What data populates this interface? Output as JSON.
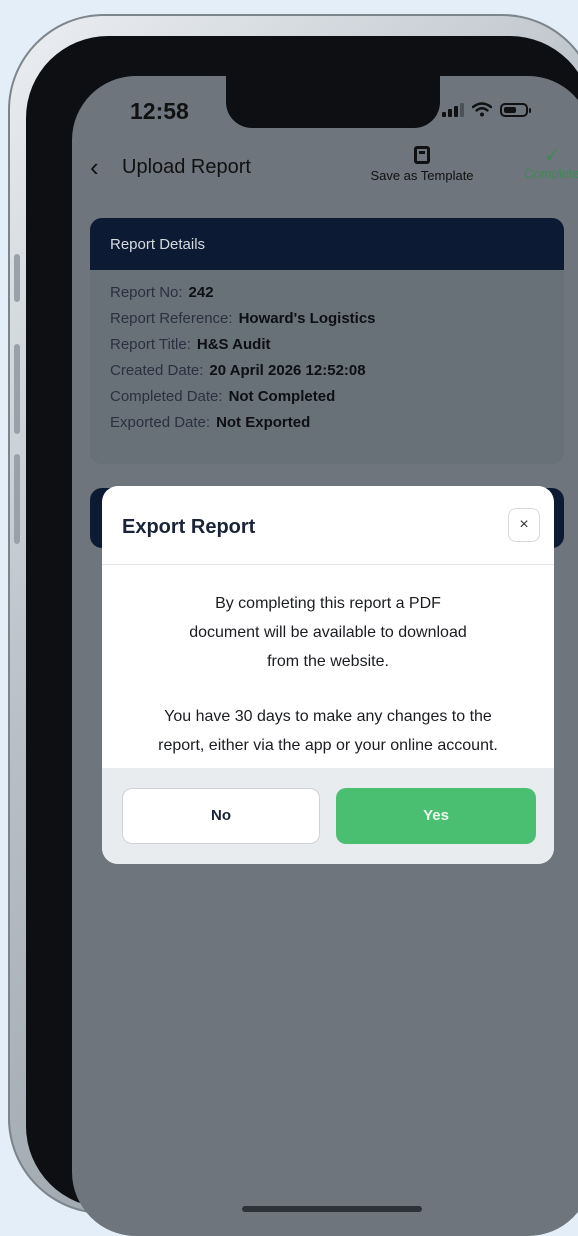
{
  "status": {
    "time": "12:58"
  },
  "header": {
    "title": "Upload Report",
    "save_template": "Save as Template",
    "complete": "Complete"
  },
  "card": {
    "title": "Report Details",
    "rows": [
      {
        "label": "Report No:",
        "value": "242"
      },
      {
        "label": "Report Reference:",
        "value": "Howard's Logistics"
      },
      {
        "label": "Report Title:",
        "value": "H&S Audit"
      },
      {
        "label": "Created Date:",
        "value": "20 April 2026 12:52:08"
      },
      {
        "label": "Completed Date:",
        "value": "Not Completed"
      },
      {
        "label": "Exported Date:",
        "value": "Not Exported"
      }
    ]
  },
  "modal": {
    "title": "Export Report",
    "close": "×",
    "line1": "By completing this report a PDF",
    "line2": "document will be available to download",
    "line3": "from the website.",
    "line4": "You have 30 days to make any changes to the",
    "line5": "report, either via the app or your online account.",
    "no_label": "No",
    "yes_label": "Yes"
  },
  "colors": {
    "accent_green": "#4bbf71",
    "navy": "#0c1a33"
  }
}
